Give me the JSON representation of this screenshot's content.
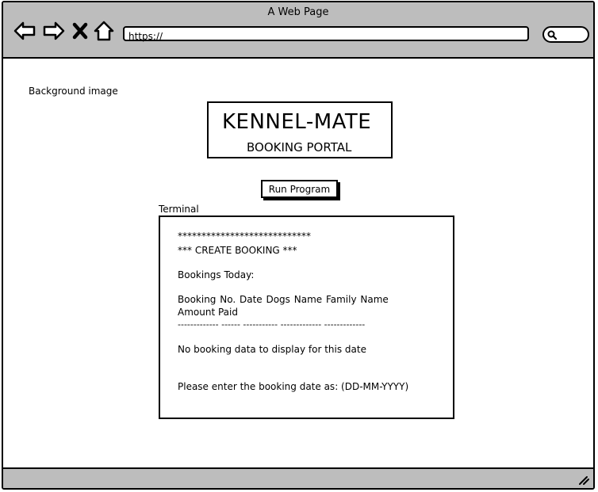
{
  "window": {
    "title": "A Web Page"
  },
  "url": {
    "value": "https://"
  },
  "page": {
    "background_label": "Background image",
    "logo": {
      "title": "KENNEL-MATE",
      "subtitle": "BOOKING PORTAL"
    },
    "run_button": "Run Program",
    "terminal_label": "Terminal",
    "terminal_lines": [
      "****************************",
      "*** CREATE BOOKING ***",
      "Bookings Today:",
      "Booking No.    Date    Dogs Name    Family Name",
      "Amount Paid",
      "------------- ------ ----------- ------------- -------------",
      "No booking data to display for this date",
      "Please enter the booking date as: (DD-MM-YYYY)"
    ]
  },
  "icons": {
    "back": "back-arrow-icon",
    "forward": "forward-arrow-icon",
    "close": "close-icon",
    "home": "home-icon",
    "search": "search-icon",
    "resize": "resize-grip-icon"
  }
}
